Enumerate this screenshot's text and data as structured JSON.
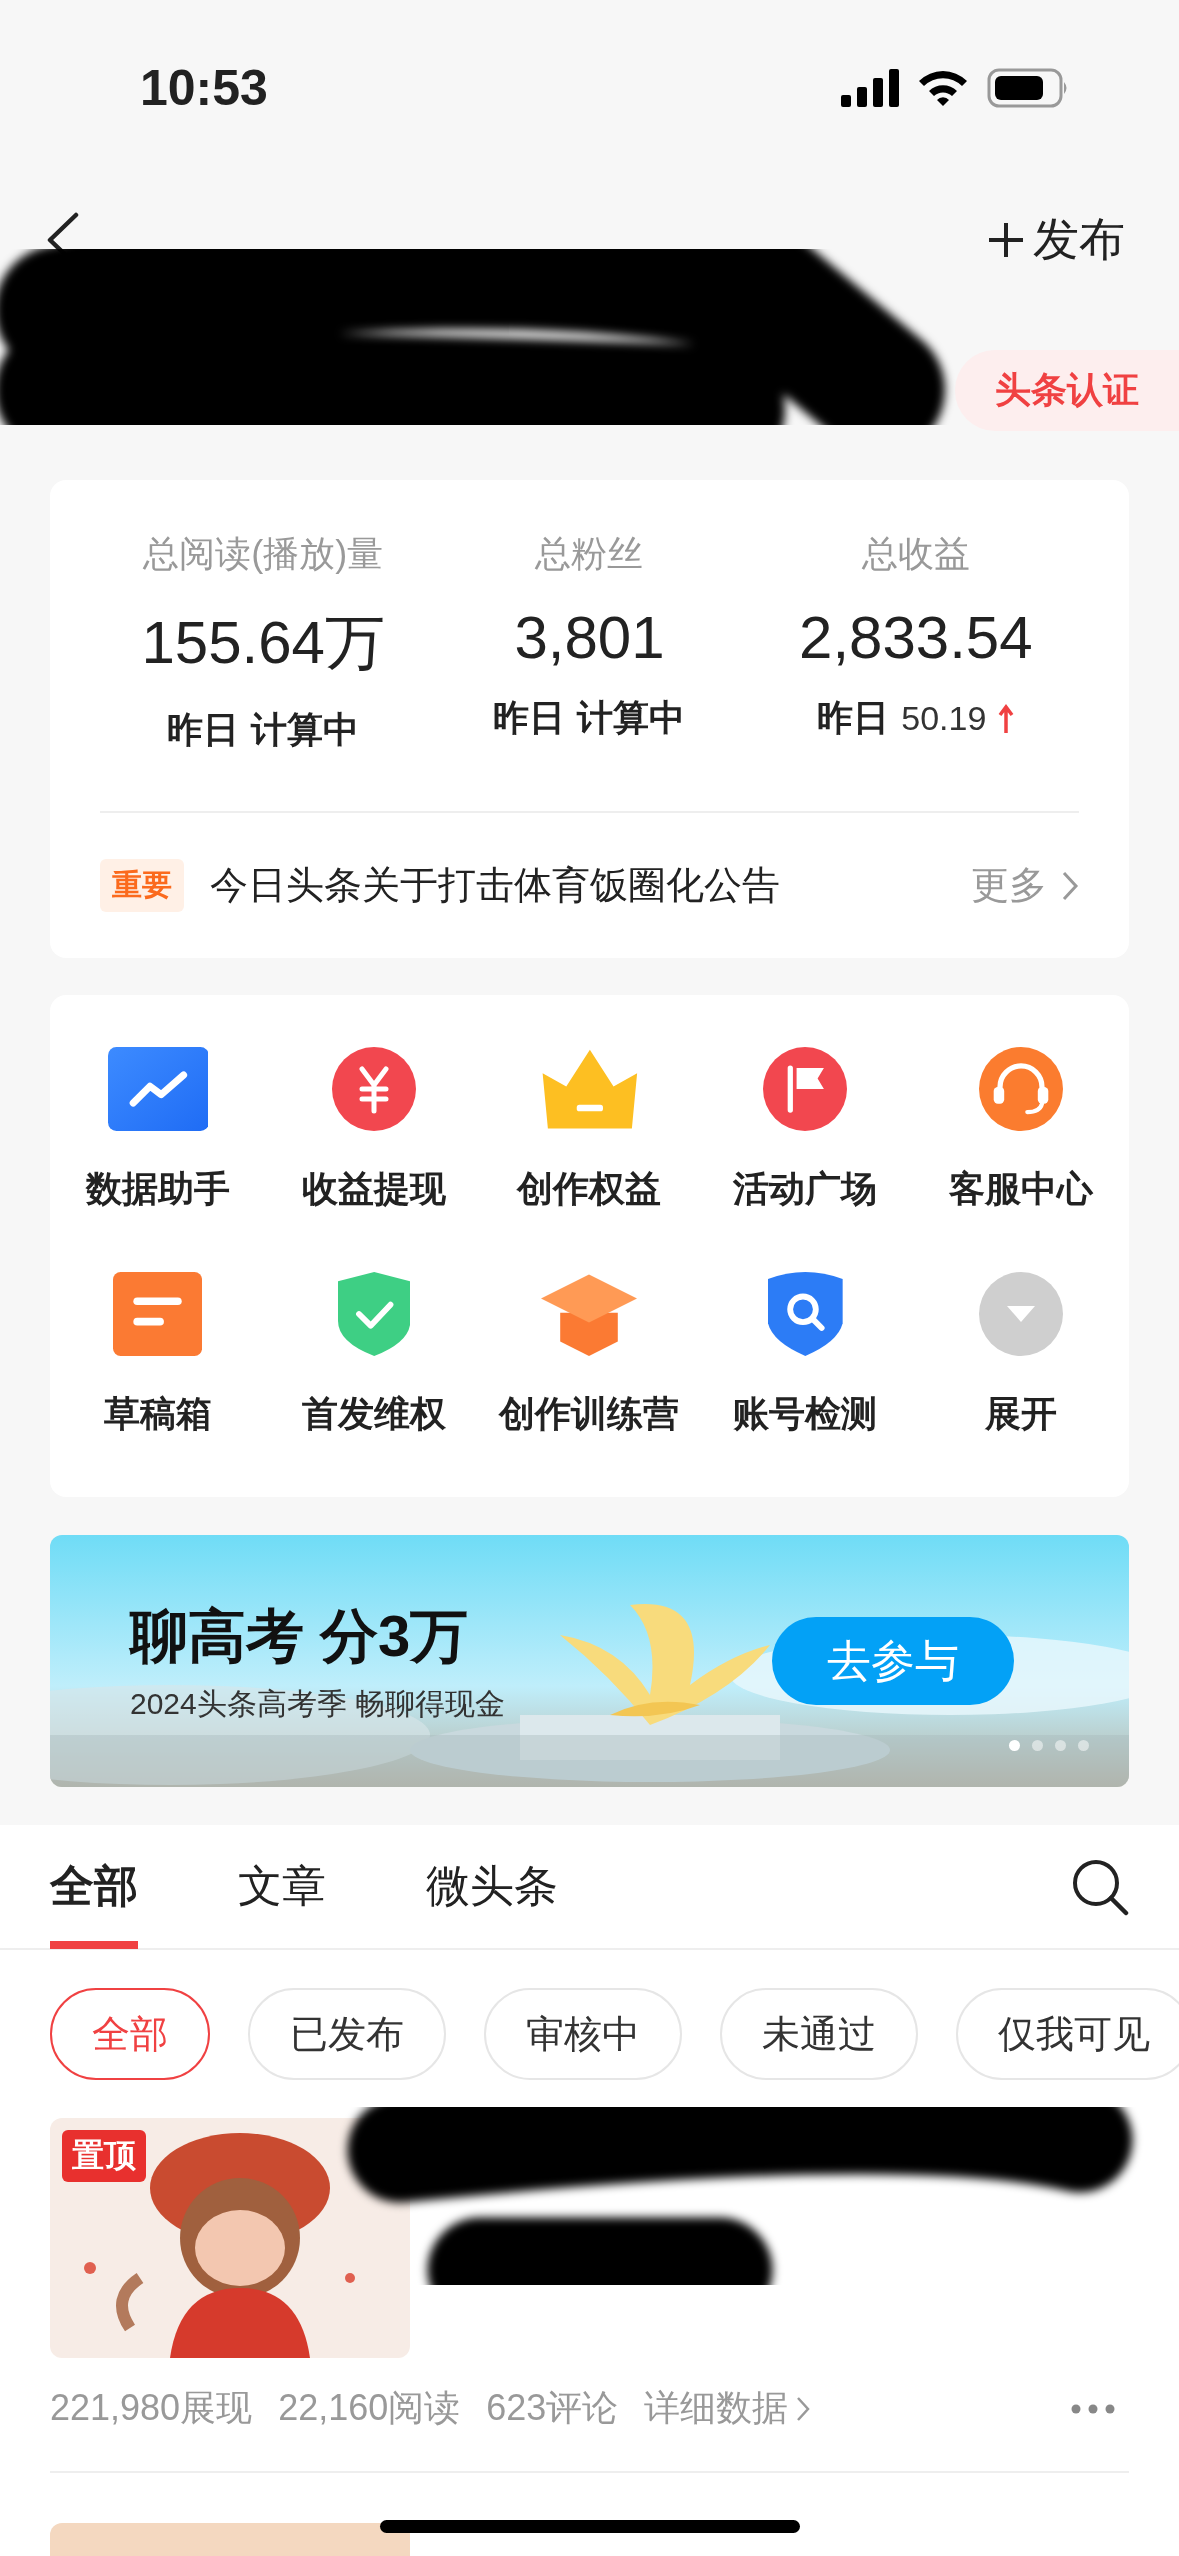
{
  "status_bar": {
    "time": "10:53"
  },
  "nav": {
    "publish": "发布"
  },
  "certification_badge": "头条认证",
  "stats": [
    {
      "label": "总阅读(播放)量",
      "value": "155.64万",
      "yesterday_label": "昨日",
      "yesterday_value": "计算中",
      "kind": "status"
    },
    {
      "label": "总粉丝",
      "value": "3,801",
      "yesterday_label": "昨日",
      "yesterday_value": "计算中",
      "kind": "status"
    },
    {
      "label": "总收益",
      "value": "2,833.54",
      "yesterday_label": "昨日",
      "yesterday_value": "50.19",
      "kind": "rising"
    }
  ],
  "notice": {
    "tag": "重要",
    "text": "今日头条关于打击体育饭圈化公告",
    "more": "更多"
  },
  "tools": [
    {
      "label": "数据助手",
      "kind": "chart"
    },
    {
      "label": "收益提现",
      "kind": "yuan"
    },
    {
      "label": "创作权益",
      "kind": "crown"
    },
    {
      "label": "活动广场",
      "kind": "flag"
    },
    {
      "label": "客服中心",
      "kind": "headset"
    },
    {
      "label": "草稿箱",
      "kind": "draft"
    },
    {
      "label": "首发维权",
      "kind": "shield"
    },
    {
      "label": "创作训练营",
      "kind": "course"
    },
    {
      "label": "账号检测",
      "kind": "check"
    },
    {
      "label": "展开",
      "kind": "expand"
    }
  ],
  "banner": {
    "title": "聊高考 分3万",
    "subtitle": "2024头条高考季 畅聊得现金",
    "button": "去参与",
    "slides": [
      {
        "selected": true
      },
      {
        "selected": false
      },
      {
        "selected": false
      },
      {
        "selected": false
      }
    ]
  },
  "tabs": [
    {
      "label": "全部",
      "selected": true
    },
    {
      "label": "文章",
      "selected": false
    },
    {
      "label": "微头条",
      "selected": false
    }
  ],
  "filters": [
    {
      "label": "全部",
      "selected": true
    },
    {
      "label": "已发布",
      "selected": false
    },
    {
      "label": "审核中",
      "selected": false
    },
    {
      "label": "未通过",
      "selected": false
    },
    {
      "label": "仅我可见",
      "selected": false
    }
  ],
  "articles": [
    {
      "pin_label": "置顶",
      "stats": [
        "221,980展现",
        "22,160阅读",
        "623评论"
      ],
      "details": "详细数据"
    },
    {
      "kind": "picture"
    }
  ]
}
